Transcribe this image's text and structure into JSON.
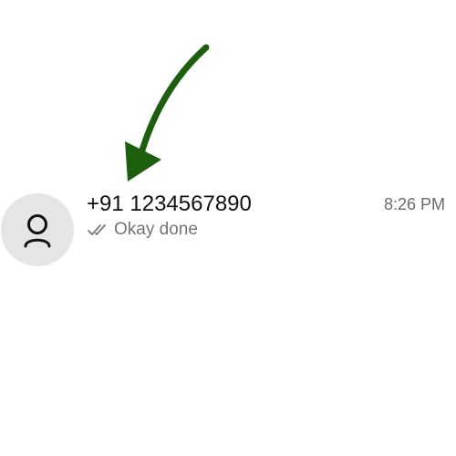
{
  "chat": {
    "contact_name": "+91 1234567890",
    "time": "8:26 PM",
    "last_message": "Okay done",
    "delivery_status": "read",
    "avatar_icon": "person-icon"
  },
  "annotation": {
    "arrow_color": "#1e5e0f"
  }
}
